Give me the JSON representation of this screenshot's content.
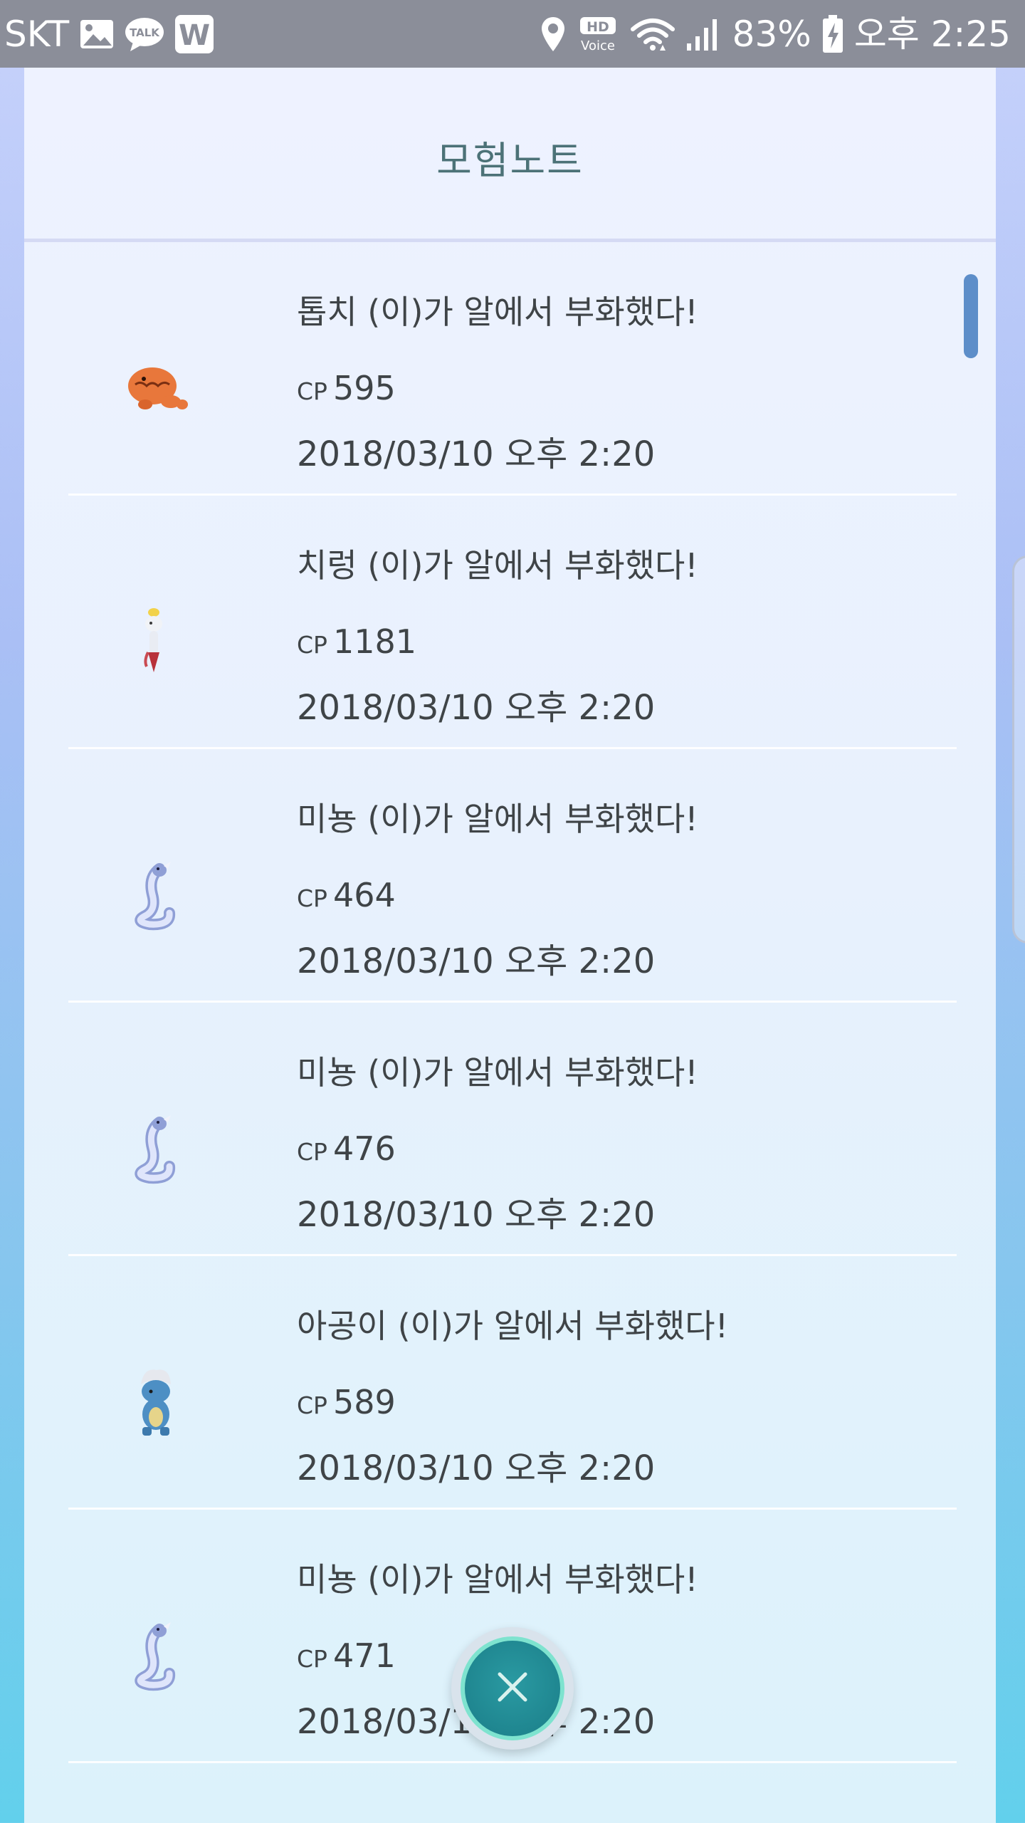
{
  "status_bar": {
    "carrier": "SKT",
    "battery_percent": "83%",
    "time": "오후 2:25",
    "hd_label": "HD",
    "voice_label": "Voice",
    "talk_label": "TALK",
    "w_label": "W"
  },
  "journal": {
    "title": "모험노트",
    "cp_label": "CP",
    "entries": [
      {
        "title": "톱치 (이)가 알에서 부화했다!",
        "cp": "595",
        "date": "2018/03/10 오후 2:20",
        "icon": "trapinch-icon"
      },
      {
        "title": "치렁 (이)가 알에서 부화했다!",
        "cp": "1181",
        "date": "2018/03/10 오후 2:20",
        "icon": "chimecho-icon"
      },
      {
        "title": "미뇽 (이)가 알에서 부화했다!",
        "cp": "464",
        "date": "2018/03/10 오후 2:20",
        "icon": "dratini-icon"
      },
      {
        "title": "미뇽 (이)가 알에서 부화했다!",
        "cp": "476",
        "date": "2018/03/10 오후 2:20",
        "icon": "dratini-icon"
      },
      {
        "title": "아공이 (이)가 알에서 부화했다!",
        "cp": "589",
        "date": "2018/03/10 오후 2:20",
        "icon": "bagon-icon"
      },
      {
        "title": "미뇽 (이)가 알에서 부화했다!",
        "cp": "471",
        "date": "2018/03/10 오후 2:20",
        "icon": "dratini-icon"
      }
    ]
  },
  "colors": {
    "status_bar_bg": "#8b8e99",
    "title_color": "#4c7277",
    "text_color": "#3f4447",
    "close_button": "#1f8690",
    "scrollbar": "#5d8ec9"
  }
}
